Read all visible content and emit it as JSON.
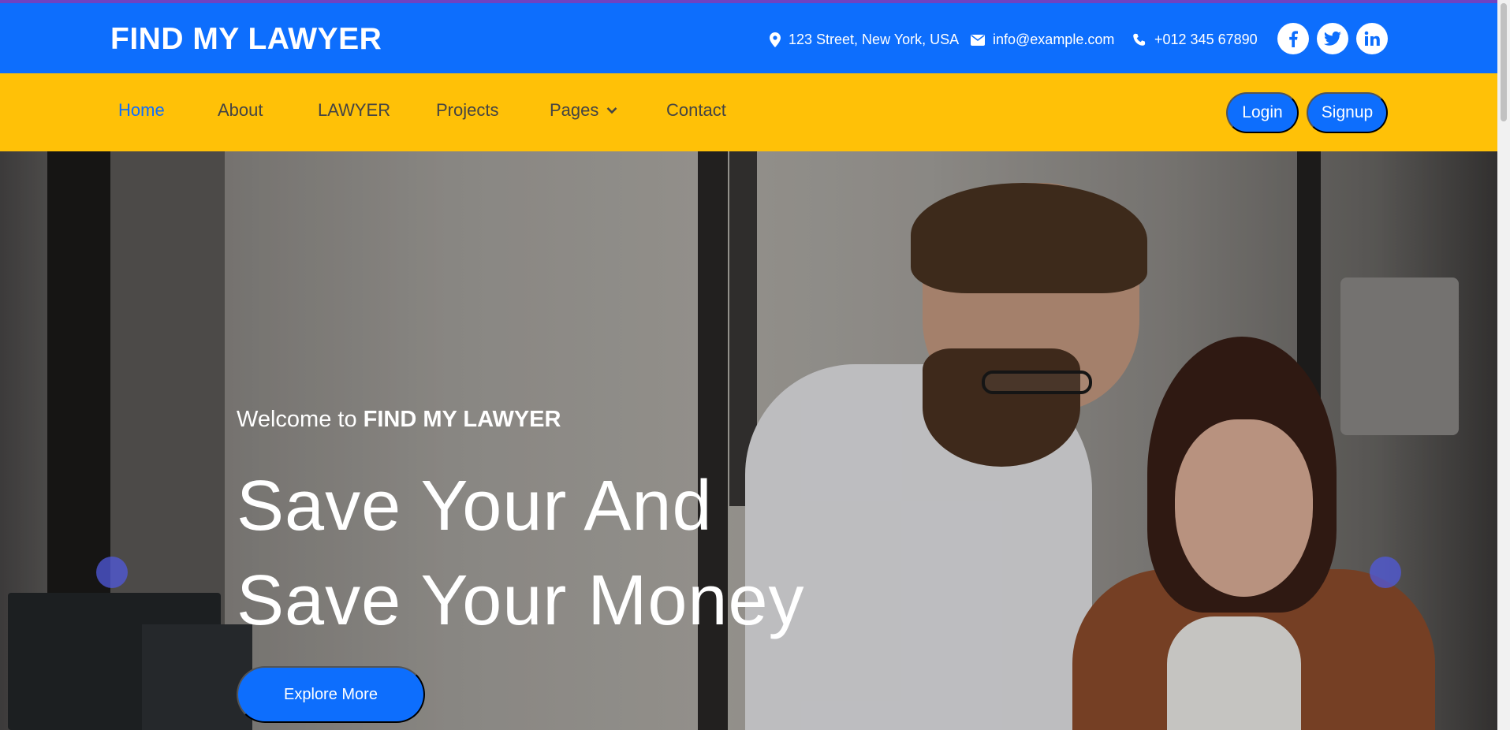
{
  "header": {
    "brand": "FIND MY LAWYER",
    "address": "123 Street, New York, USA",
    "email": "info@example.com",
    "phone": "+012 345 67890",
    "social": [
      "facebook-icon",
      "twitter-icon",
      "linkedin-icon"
    ]
  },
  "nav": {
    "items": [
      "Home",
      "About",
      "LAWYER",
      "Projects",
      "Pages",
      "Contact"
    ],
    "active": "Home",
    "login_label": "Login",
    "signup_label": "Signup"
  },
  "hero": {
    "welcome_prefix": "Welcome to",
    "welcome_brand": "FIND MY LAWYER",
    "headline_line1": "Save Your And",
    "headline_line2": "Save Your Money",
    "cta_label": "Explore More"
  },
  "colors": {
    "primary": "#0d6efd",
    "accent": "#ffc107"
  }
}
